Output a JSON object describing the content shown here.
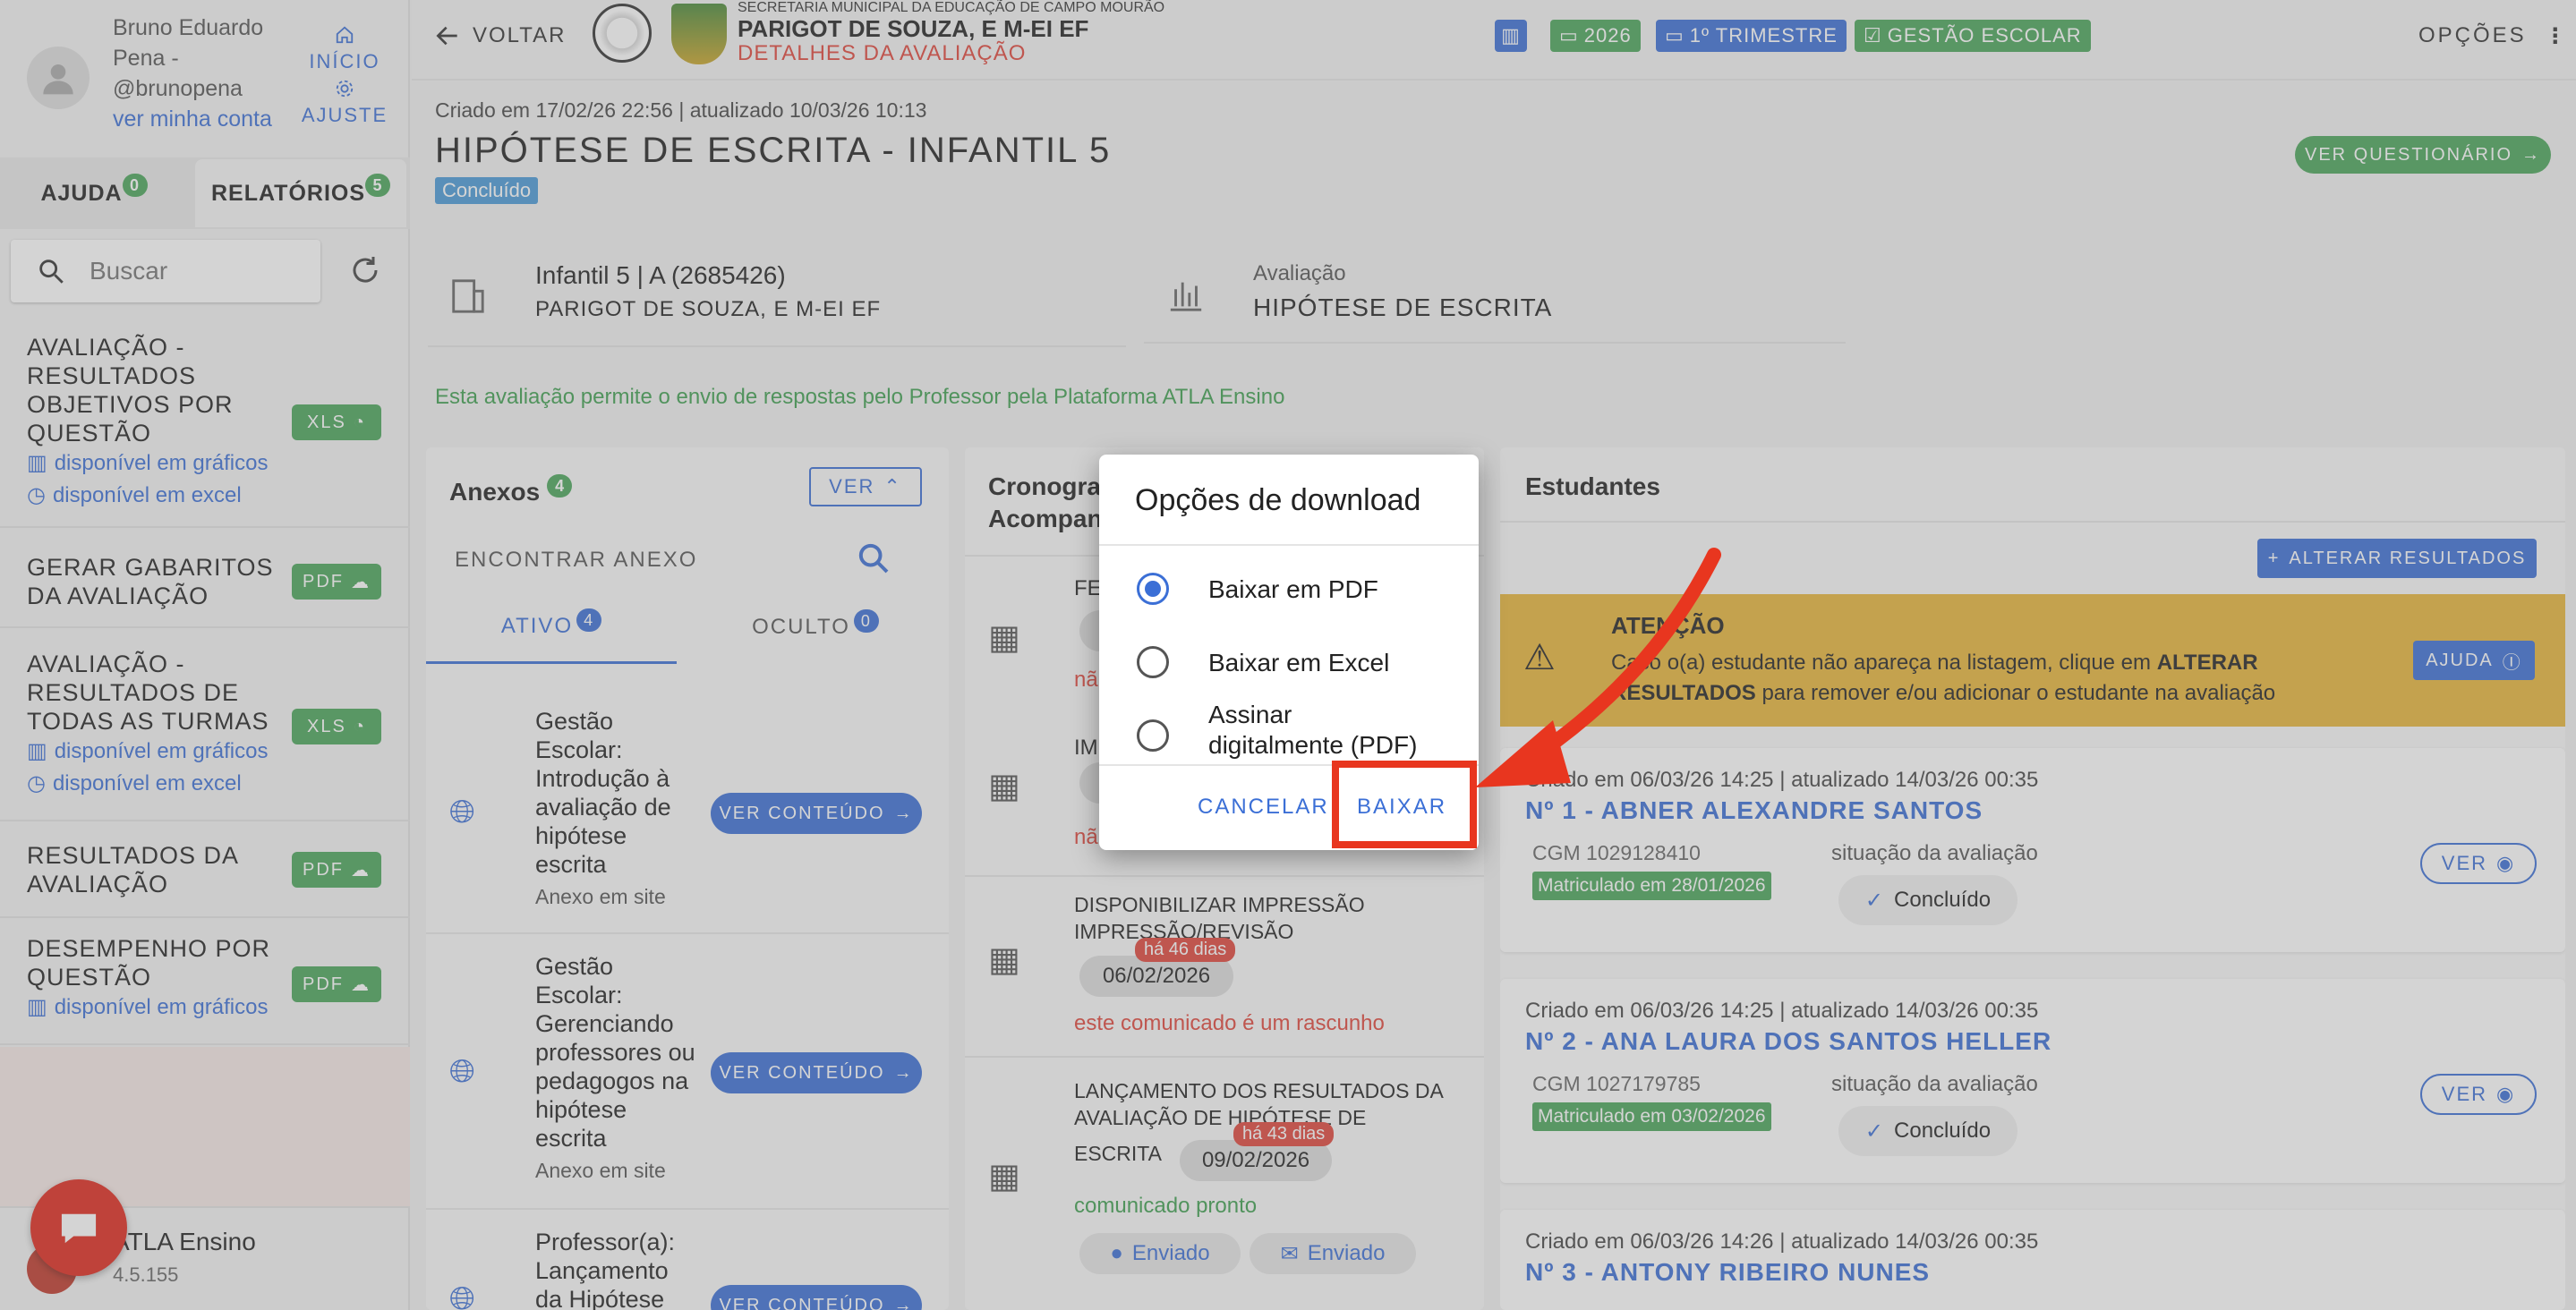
{
  "user": {
    "name_line1": "Bruno Eduardo",
    "name_line2": "Pena -",
    "handle": "@brunopena",
    "profile_link": "ver minha conta",
    "home": "INÍCIO",
    "settings": "AJUSTE"
  },
  "tabs": {
    "help": "AJUDA",
    "help_count": "0",
    "reports": "RELATÓRIOS",
    "reports_count": "5"
  },
  "search": {
    "placeholder": "Buscar"
  },
  "reports": [
    {
      "title": [
        "AVALIAÇÃO -",
        "RESULTADOS",
        "OBJETIVOS POR",
        "QUESTÃO"
      ],
      "format": "XLS",
      "subs": [
        "disponível em gráficos",
        "disponível em excel"
      ]
    },
    {
      "title": [
        "GERAR GABARITOS",
        "DA AVALIAÇÃO"
      ],
      "format": "PDF",
      "subs": []
    },
    {
      "title": [
        "AVALIAÇÃO -",
        "RESULTADOS DE",
        "TODAS AS TURMAS"
      ],
      "format": "XLS",
      "subs": [
        "disponível em gráficos",
        "disponível em excel"
      ]
    },
    {
      "title": [
        "RESULTADOS DA",
        "AVALIAÇÃO"
      ],
      "format": "PDF",
      "subs": []
    },
    {
      "title": [
        "DESEMPENHO POR",
        "QUESTÃO"
      ],
      "format": "PDF",
      "subs": [
        "disponível em gráficos"
      ]
    }
  ],
  "footer": {
    "app": "ATLA Ensino",
    "version": "4.5.155"
  },
  "header": {
    "back": "VOLTAR",
    "secretaria": "SECRETARIA MUNICIPAL DA EDUCAÇÃO DE CAMPO MOURÃO",
    "school": "PARIGOT DE SOUZA, E M-EI EF",
    "page": "DETALHES DA AVALIAÇÃO",
    "year": "2026",
    "term": "1º TRIMESTRE",
    "mode": "GESTÃO ESCOLAR",
    "options": "OPÇÕES"
  },
  "evaluation": {
    "meta": "Criado em 17/02/26 22:56 | atualizado 10/03/26 10:13",
    "title": "HIPÓTESE DE ESCRITA - INFANTIL 5",
    "status": "Concluído",
    "questionnaire_btn": "VER QUESTIONÁRIO",
    "class_line": "Infantil 5 | A (2685426)",
    "school_line": "PARIGOT DE SOUZA, E M-EI EF",
    "eval_label": "Avaliação",
    "eval_name": "HIPÓTESE DE ESCRITA",
    "notice": "Esta avaliação permite o envio de respostas pelo Professor pela Plataforma ATLA Ensino"
  },
  "attachments": {
    "title": "Anexos",
    "count": "4",
    "toggle": "VER",
    "find": "ENCONTRAR ANEXO",
    "tab_active": "ATIVO",
    "tab_active_count": "4",
    "tab_hidden": "OCULTO",
    "tab_hidden_count": "0",
    "view_btn": "VER CONTEÚDO",
    "items": [
      {
        "title": [
          "Gestão",
          "Escolar:",
          "Introdução à",
          "avaliação de",
          "hipótese",
          "escrita"
        ],
        "sub": "Anexo em site"
      },
      {
        "title": [
          "Gestão",
          "Escolar:",
          "Gerenciando",
          "professores ou",
          "pedagogos na",
          "hipótese",
          "escrita"
        ],
        "sub": "Anexo em site"
      },
      {
        "title": [
          "Professor(a):",
          "Lançamento",
          "da Hipótese"
        ],
        "sub": ""
      }
    ]
  },
  "schedule": {
    "title_line1": "Cronogra",
    "title_line2": "Acompan",
    "items": [
      {
        "title": [
          "FE"
        ],
        "date": "",
        "ago": "",
        "note": "nã"
      },
      {
        "title": [
          "IM"
        ],
        "date": "",
        "ago": "",
        "note": "nã"
      },
      {
        "title": [
          "DISPONIBILIZAR IMPRESSÃO",
          "IMPRESSÃO/REVISÃO"
        ],
        "date": "06/02/2026",
        "ago": "há 46 dias",
        "note": "este comunicado é um rascunho"
      },
      {
        "title": [
          "LANÇAMENTO DOS RESULTADOS DA",
          "AVALIAÇÃO DE HIPÓTESE DE",
          "ESCRITA"
        ],
        "date": "09/02/2026",
        "ago": "há 43 dias",
        "note": "comunicado pronto",
        "sent1": "Enviado",
        "sent2": "Enviado"
      }
    ]
  },
  "students": {
    "title": "Estudantes",
    "alter_btn": "ALTERAR RESULTADOS",
    "alert": {
      "heading": "ATENÇÃO",
      "text1": "Caso o(a) estudante não apareça na listagem, clique em",
      "bold1": "ALTERAR",
      "bold2": "RESULTADOS",
      "text2": "para remover e/ou adicionar o estudante na avaliação",
      "help": "AJUDA"
    },
    "list": [
      {
        "meta": "Criado em 06/03/26 14:25 | atualizado 14/03/26 00:35",
        "name": "Nº 1 - ABNER ALEXANDRE SANTOS",
        "cgm": "CGM 1029128410",
        "enrolled": "Matriculado em 28/01/2026",
        "status_label": "situação da avaliação",
        "status": "Concluído",
        "view": "VER"
      },
      {
        "meta": "Criado em 06/03/26 14:25 | atualizado 14/03/26 00:35",
        "name": "Nº 2 - ANA LAURA DOS SANTOS HELLER",
        "cgm": "CGM 1027179785",
        "enrolled": "Matriculado em 03/02/2026",
        "status_label": "situação da avaliação",
        "status": "Concluído",
        "view": "VER"
      },
      {
        "meta": "Criado em 06/03/26 14:26 | atualizado 14/03/26 00:35",
        "name": "Nº 3 - ANTONY RIBEIRO NUNES"
      }
    ]
  },
  "dialog": {
    "title": "Opções de download",
    "options": [
      "Baixar em PDF",
      "Baixar em Excel",
      "Assinar",
      "digitalmente (PDF)"
    ],
    "selected": "Baixar em PDF",
    "cancel": "CANCELAR",
    "confirm": "BAIXAR"
  },
  "colors": {
    "accent": "#3b6fd6",
    "success": "#4aa55a",
    "alert": "#e8b53a",
    "danger": "#e0463b",
    "chip_green": "#4aa55a",
    "chip_blue": "#3b6fd6"
  }
}
